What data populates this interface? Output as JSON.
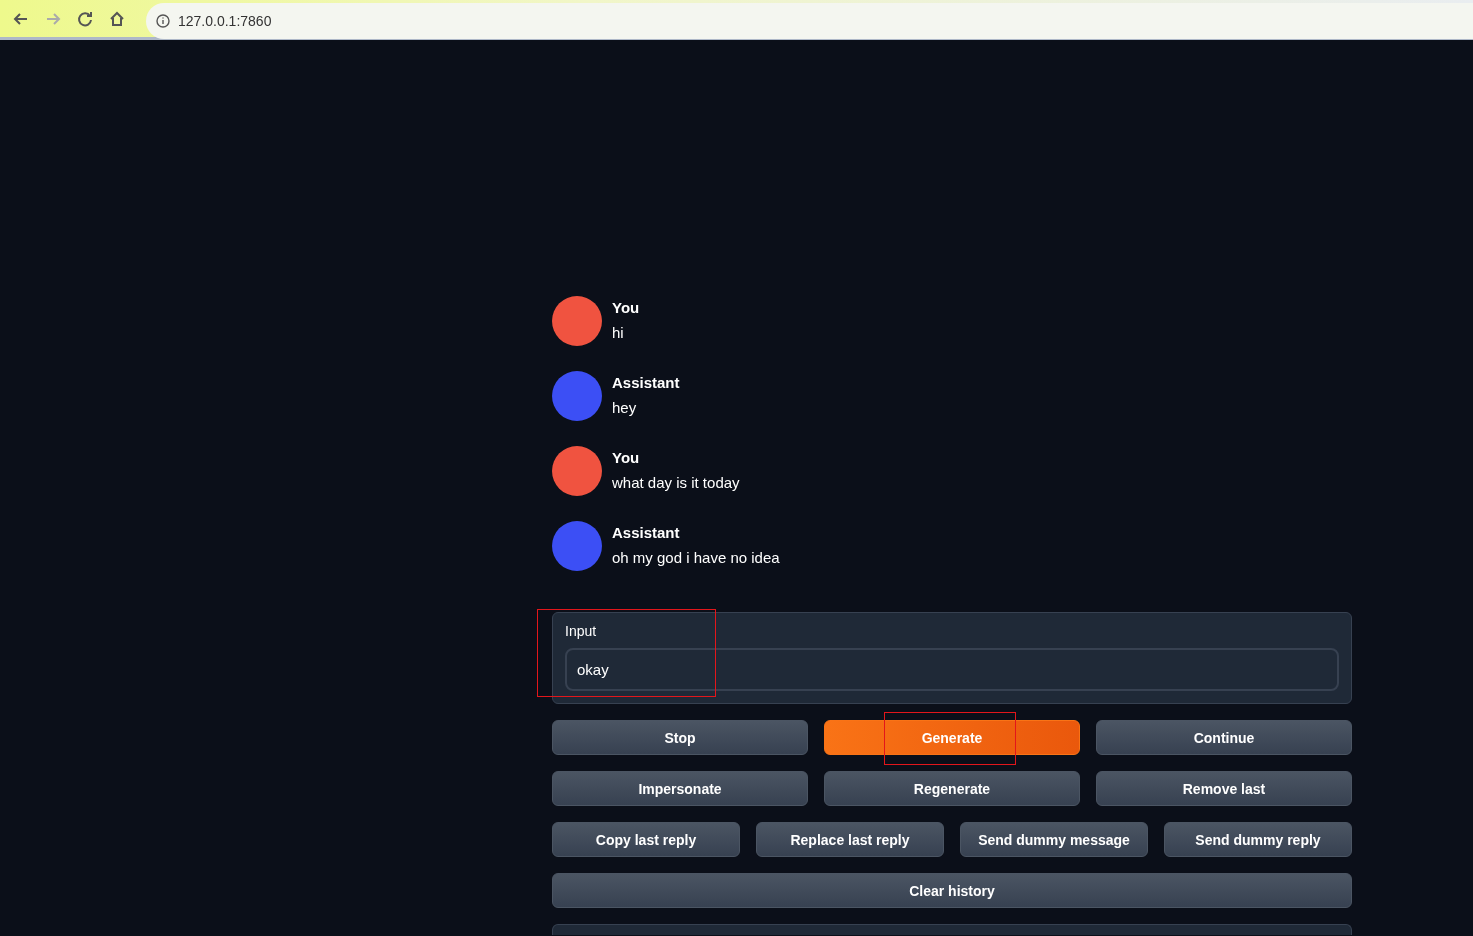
{
  "browser": {
    "address": "127.0.0.1:7860"
  },
  "messages": [
    {
      "author": "You",
      "text": "hi",
      "color": "#f05340"
    },
    {
      "author": "Assistant",
      "text": "hey",
      "color": "#3c4ff5"
    },
    {
      "author": "You",
      "text": "what day is it today",
      "color": "#f05340"
    },
    {
      "author": "Assistant",
      "text": "oh my god i have no idea",
      "color": "#3c4ff5"
    }
  ],
  "input": {
    "label": "Input",
    "value": "okay",
    "highlighted": true
  },
  "button_rows": [
    [
      {
        "label": "Stop",
        "kind": "secondary",
        "highlighted": false
      },
      {
        "label": "Generate",
        "kind": "primary",
        "highlighted": true
      },
      {
        "label": "Continue",
        "kind": "secondary",
        "highlighted": false
      }
    ],
    [
      {
        "label": "Impersonate",
        "kind": "secondary",
        "highlighted": false
      },
      {
        "label": "Regenerate",
        "kind": "secondary",
        "highlighted": false
      },
      {
        "label": "Remove last",
        "kind": "secondary",
        "highlighted": false
      }
    ],
    [
      {
        "label": "Copy last reply",
        "kind": "secondary",
        "highlighted": false
      },
      {
        "label": "Replace last reply",
        "kind": "secondary",
        "highlighted": false
      },
      {
        "label": "Send dummy message",
        "kind": "secondary",
        "highlighted": false
      },
      {
        "label": "Send dummy reply",
        "kind": "secondary",
        "highlighted": false
      }
    ],
    [
      {
        "label": "Clear history",
        "kind": "secondary",
        "highlighted": false
      }
    ]
  ]
}
